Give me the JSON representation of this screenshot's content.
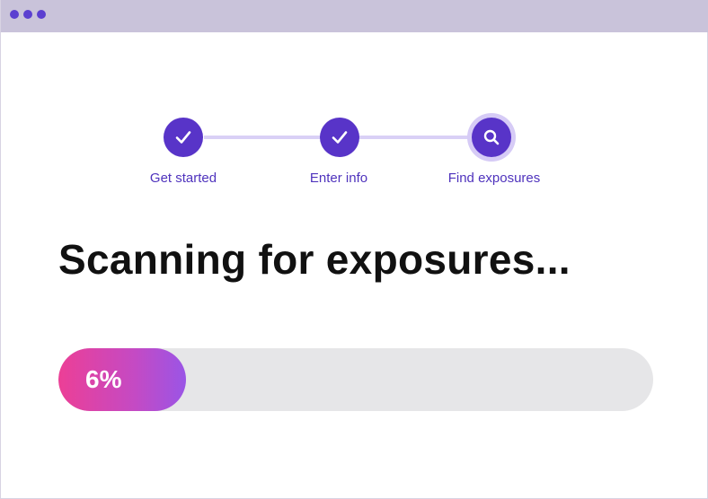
{
  "window": {
    "dots": [
      "dot",
      "dot",
      "dot"
    ],
    "accent_color": "#5834c8",
    "titlebar_color": "#c9c3da"
  },
  "stepper": {
    "steps": [
      {
        "label": "Get started",
        "status": "completed",
        "icon": "check-icon"
      },
      {
        "label": "Enter info",
        "status": "completed",
        "icon": "check-icon"
      },
      {
        "label": "Find exposures",
        "status": "active",
        "icon": "search-icon"
      }
    ]
  },
  "main": {
    "headline": "Scanning for exposures...",
    "progress": {
      "percent": 6,
      "label": "6%",
      "gradient_start": "#ec3f96",
      "gradient_end": "#9a55e6"
    }
  }
}
